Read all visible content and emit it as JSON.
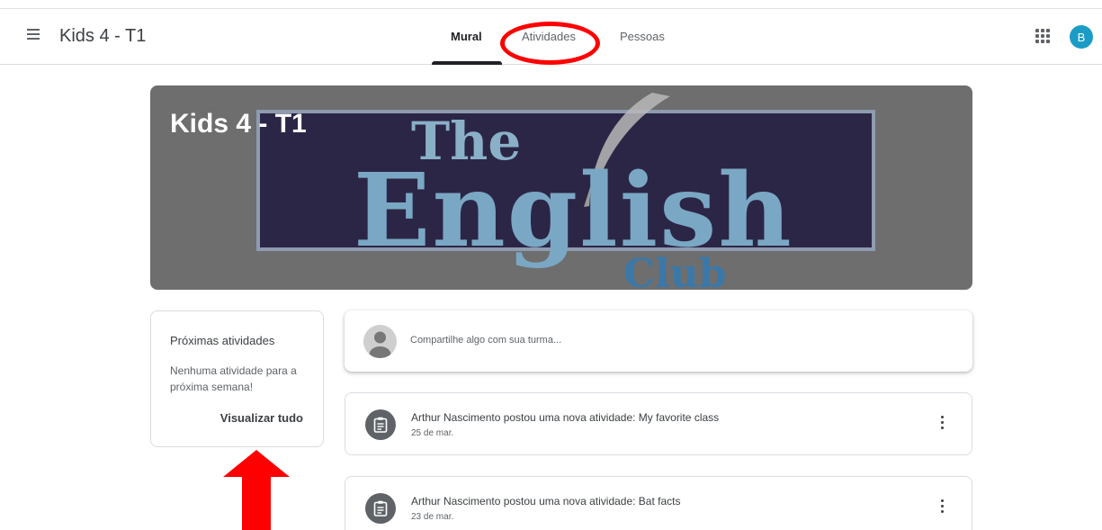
{
  "header": {
    "class_name": "Kids 4 - T1",
    "tabs": [
      {
        "label": "Mural",
        "active": true
      },
      {
        "label": "Atividades",
        "active": false
      },
      {
        "label": "Pessoas",
        "active": false
      }
    ],
    "avatar_initial": "B",
    "icons": {
      "menu": "hamburger-menu-icon",
      "apps": "apps-grid-icon"
    }
  },
  "banner": {
    "title": "Kids 4 - T1",
    "logo_text": {
      "the": "The",
      "english": "English",
      "club": "Club"
    }
  },
  "upcoming": {
    "title": "Próximas atividades",
    "empty_text": "Nenhuma atividade para a próxima semana!",
    "view_all": "Visualizar tudo"
  },
  "share": {
    "placeholder": "Compartilhe algo com sua turma..."
  },
  "posts": [
    {
      "text": "Arthur Nascimento postou uma nova atividade: My favorite class",
      "date": "25 de mar."
    },
    {
      "text": "Arthur Nascimento postou uma nova atividade: Bat facts",
      "date": "23 de mar."
    }
  ],
  "colors": {
    "accent_avatar": "#1a9cc6",
    "annotation": "#ff0000",
    "banner_overlay": "#6e6e6e",
    "logo_bg": "#2c2646",
    "logo_text": "#7aa8c4"
  }
}
